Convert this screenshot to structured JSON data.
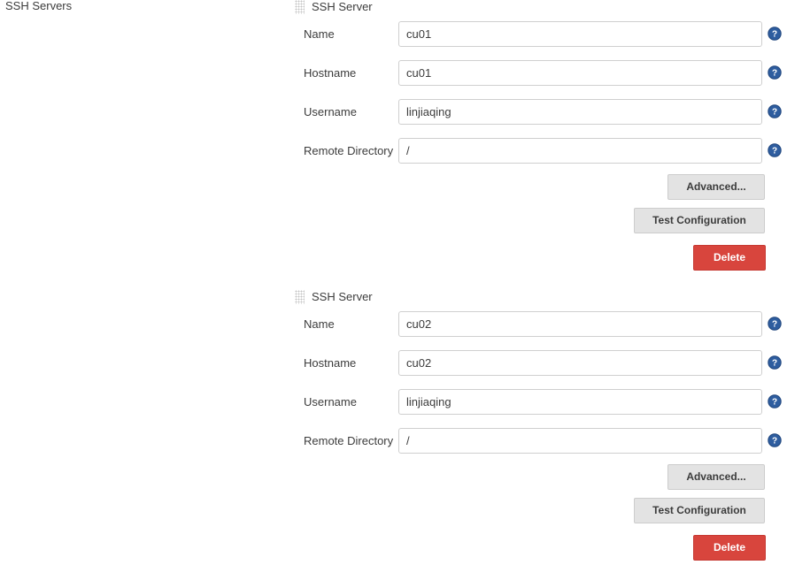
{
  "page": {
    "title": "SSH Servers"
  },
  "icons": {
    "drag_handle": "drag-handle-icon",
    "help": "help-circle-icon"
  },
  "labels": {
    "card_title": "SSH Server",
    "name": "Name",
    "hostname": "Hostname",
    "username": "Username",
    "remote_directory": "Remote Directory"
  },
  "buttons": {
    "advanced": "Advanced...",
    "test_configuration": "Test Configuration",
    "delete": "Delete"
  },
  "colors": {
    "danger": "#d8453d",
    "button_face": "#e3e3e3",
    "text": "#3c3c3c",
    "input_border": "#cfcfcf",
    "help_icon": "#2e5d9f"
  },
  "servers": [
    {
      "title": "SSH Server",
      "name": "cu01",
      "hostname": "cu01",
      "username": "linjiaqing",
      "remote_directory": "/",
      "name_placeholder": "",
      "hostname_placeholder": "",
      "username_placeholder": "",
      "remote_directory_placeholder": ""
    },
    {
      "title": "SSH Server",
      "name": "cu02",
      "hostname": "cu02",
      "username": "linjiaqing",
      "remote_directory": "/",
      "name_placeholder": "",
      "hostname_placeholder": "",
      "username_placeholder": "",
      "remote_directory_placeholder": ""
    }
  ]
}
